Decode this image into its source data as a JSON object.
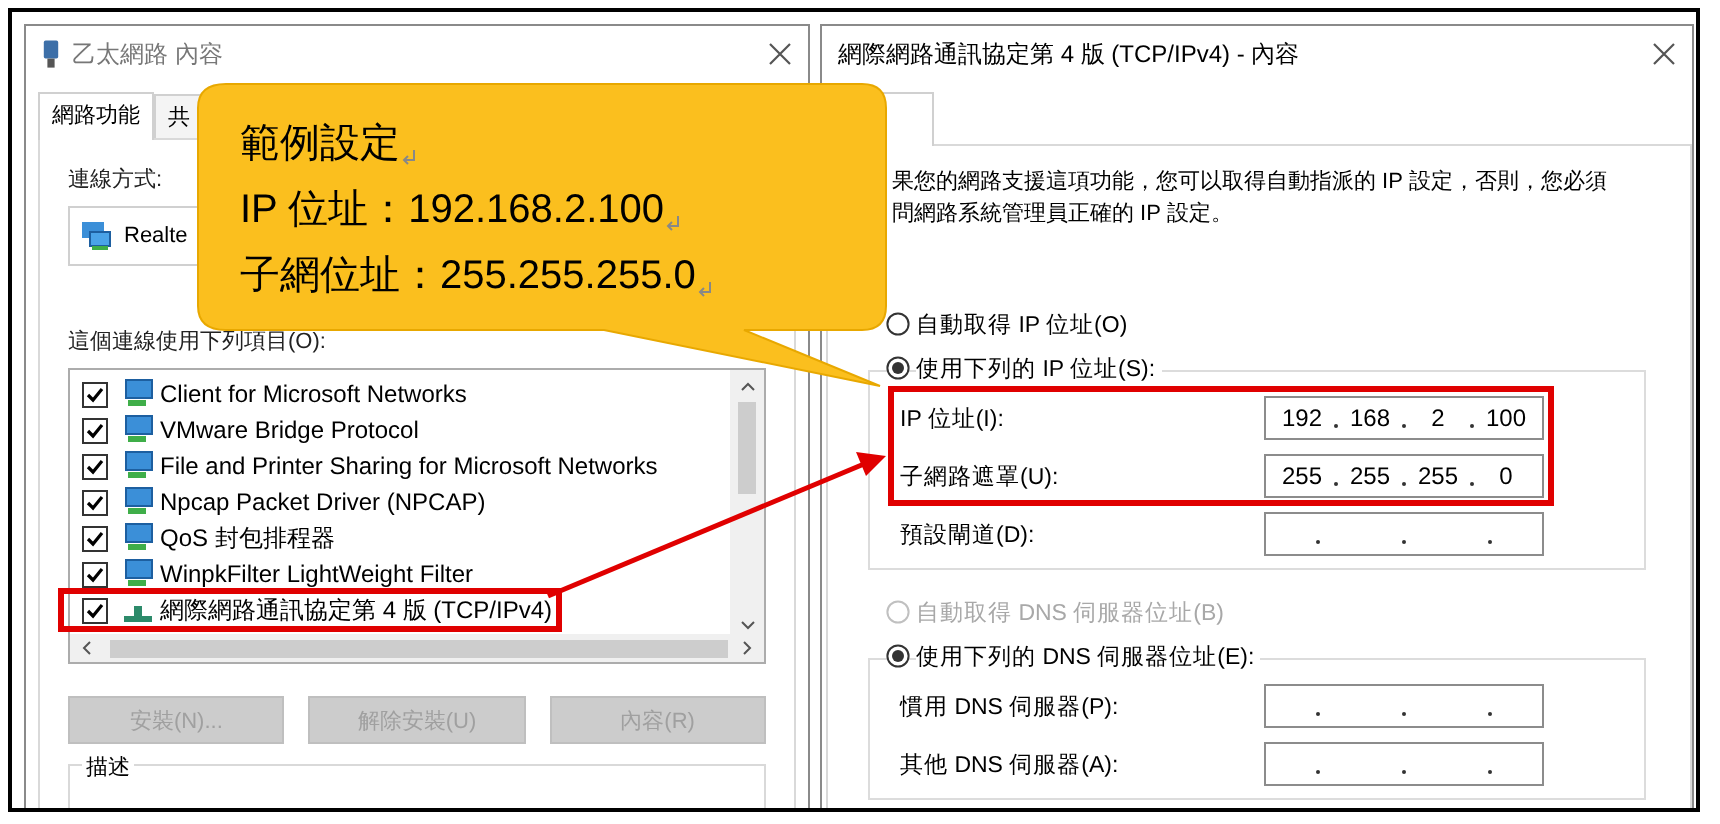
{
  "left_window": {
    "title": "乙太網路 內容",
    "tabs": [
      {
        "label": "網路功能",
        "selected": true
      },
      {
        "label": "共",
        "selected": false
      }
    ],
    "connect_label": "連線方式:",
    "adapter": "Realte",
    "items_label": "這個連線使用下列項目(O):",
    "items": [
      {
        "kind": "client",
        "label": "Client for Microsoft Networks",
        "checked": true,
        "highlighted": false
      },
      {
        "kind": "client",
        "label": "VMware Bridge Protocol",
        "checked": true,
        "highlighted": false
      },
      {
        "kind": "client",
        "label": "File and Printer Sharing for Microsoft Networks",
        "checked": true,
        "highlighted": false
      },
      {
        "kind": "client",
        "label": "Npcap Packet Driver (NPCAP)",
        "checked": true,
        "highlighted": false
      },
      {
        "kind": "client",
        "label": "QoS 封包排程器",
        "checked": true,
        "highlighted": false
      },
      {
        "kind": "client",
        "label": "WinpkFilter LightWeight Filter",
        "checked": true,
        "highlighted": false
      },
      {
        "kind": "protocol",
        "label": "網際網路通訊協定第 4 版 (TCP/IPv4)",
        "checked": true,
        "highlighted": true
      }
    ],
    "buttons": [
      {
        "label": "安裝(N)...",
        "disabled": true
      },
      {
        "label": "解除安裝(U)",
        "disabled": true
      },
      {
        "label": "內容(R)",
        "disabled": true
      }
    ],
    "description_label": "描述"
  },
  "right_window": {
    "title": "網際網路通訊協定第 4 版 (TCP/IPv4) - 內容",
    "intro": [
      "果您的網路支援這項功能，您可以取得自動指派的 IP 設定，否則，您必須",
      "問網路系統管理員正確的 IP 設定。"
    ],
    "ip_options": [
      {
        "label": "自動取得 IP 位址(O)",
        "selected": false,
        "disabled": false
      },
      {
        "label": "使用下列的 IP 位址(S):",
        "selected": true,
        "disabled": false
      }
    ],
    "ip_fields": [
      {
        "label": "IP 位址(I):",
        "octets": [
          "192",
          "168",
          "2",
          "100"
        ],
        "highlighted": true
      },
      {
        "label": "子網路遮罩(U):",
        "octets": [
          "255",
          "255",
          "255",
          "0"
        ],
        "highlighted": true
      },
      {
        "label": "預設閘道(D):",
        "highlighted": false
      }
    ],
    "dns_options": [
      {
        "label": "自動取得 DNS 伺服器位址(B)",
        "selected": false,
        "disabled": true
      },
      {
        "label": "使用下列的 DNS 伺服器位址(E):",
        "selected": true,
        "disabled": false
      }
    ],
    "dns_fields": [
      {
        "label": "慣用 DNS 伺服器(P):"
      },
      {
        "label": "其他 DNS 伺服器(A):"
      }
    ]
  },
  "callout": {
    "lines": [
      "範例設定",
      "IP 位址：192.168.2.100",
      "子網位址：255.255.255.0"
    ]
  }
}
